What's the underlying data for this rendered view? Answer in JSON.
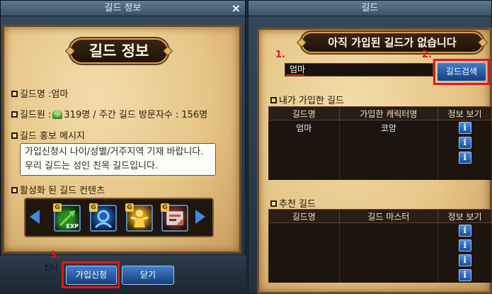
{
  "left_window": {
    "title": "길드 정보",
    "close_glyph": "×",
    "plate_title": "길드 정보",
    "guild_name_row": "길드명 :엄마",
    "members_prefix": "길드원 :",
    "members_rest": "319명 / 주간 길드 방문자수 : 156명",
    "promo_heading": "길드 홍보 메시지",
    "promo_line1": "가입신청시 나이/성별/거주지역 기재 바랍니다.",
    "promo_line2": "우리 길드는 성인 친목 길드입니다.",
    "content_heading": "활성화 된 길드 컨텐츠",
    "content_icons": [
      {
        "icon": "exp-boost-icon",
        "badge": "G",
        "label": "EXP"
      },
      {
        "icon": "guild-member-icon",
        "badge": "G",
        "label": ""
      },
      {
        "icon": "golden-warrior-icon",
        "badge": "G",
        "label": ""
      },
      {
        "icon": "guild-board-icon",
        "badge": "G",
        "label": ""
      }
    ],
    "bottom_label": "신나",
    "join_button": "가입신청",
    "close_button": "닫기"
  },
  "right_window": {
    "title": "길드",
    "plate_title": "아직 가입된 길드가 없습니다",
    "search_value": "엄마",
    "search_button": "길드검색",
    "my_guild_heading": "내가 가입한 길드",
    "my_guild_headers": [
      "길드명",
      "가입한 캐릭터명",
      "정보 보기"
    ],
    "my_guild_rows": [
      {
        "guild": "엄마",
        "character": "코앙"
      }
    ],
    "recommended_heading": "추천 길드",
    "recommended_headers": [
      "길드명",
      "길드 마스터",
      "정보 보기"
    ],
    "info_glyph": "i"
  },
  "annotations": {
    "one": "1.",
    "two": "2.",
    "three": "3.",
    "color": "#e01818"
  }
}
